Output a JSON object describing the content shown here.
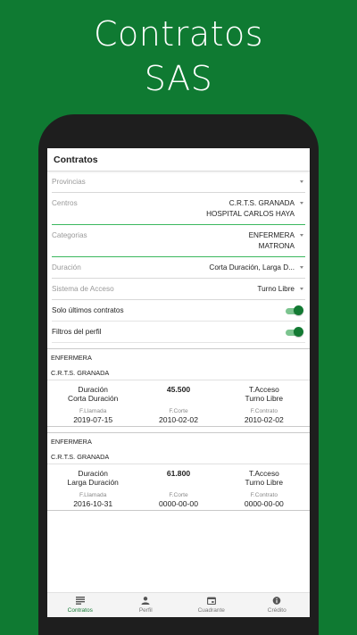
{
  "promo": {
    "line1": "Contratos",
    "line2": "SAS"
  },
  "appbar": {
    "title": "Contratos"
  },
  "filters": {
    "provincias": {
      "label": "Provincias",
      "value": ""
    },
    "centros": {
      "label": "Centros",
      "value_lines": [
        "C.R.T.S. GRANADA",
        "HOSPITAL CARLOS HAYA"
      ]
    },
    "categorias": {
      "label": "Categorias",
      "value_lines": [
        "ENFERMERA",
        "MATRONA"
      ]
    },
    "duracion": {
      "label": "Duración",
      "value": "Corta Duración, Larga D..."
    },
    "acceso": {
      "label": "Sistema de Acceso",
      "value": "Turno Libre"
    }
  },
  "toggles": {
    "ultimos": {
      "label": "Solo últimos contratos",
      "on": true
    },
    "perfil": {
      "label": "Filtros del perfil",
      "on": true
    }
  },
  "contracts": [
    {
      "categoria": "ENFERMERA",
      "centro": "C.R.T.S. GRANADA",
      "duracion_label": "Duración",
      "duracion": "Corta Duración",
      "puntos": "45.500",
      "acceso_label": "T.Acceso",
      "acceso": "Turno Libre",
      "f_llamada_label": "F.Llamada",
      "f_llamada": "2019-07-15",
      "f_corte_label": "F.Corte",
      "f_corte": "2010-02-02",
      "f_contrato_label": "F.Contrato",
      "f_contrato": "2010-02-02"
    },
    {
      "categoria": "ENFERMERA",
      "centro": "C.R.T.S. GRANADA",
      "duracion_label": "Duración",
      "duracion": "Larga Duración",
      "puntos": "61.800",
      "acceso_label": "T.Acceso",
      "acceso": "Turno Libre",
      "f_llamada_label": "F.Llamada",
      "f_llamada": "2016-10-31",
      "f_corte_label": "F.Corte",
      "f_corte": "0000-00-00",
      "f_contrato_label": "F.Contrato",
      "f_contrato": "0000-00-00"
    }
  ],
  "bottom_nav": [
    {
      "label": "Contratos",
      "icon": "list-icon",
      "active": true
    },
    {
      "label": "Perfil",
      "icon": "person-icon",
      "active": false
    },
    {
      "label": "Cuadrante",
      "icon": "calendar-icon",
      "active": false
    },
    {
      "label": "Crédito",
      "icon": "info-icon",
      "active": false
    }
  ],
  "colors": {
    "brand_green": "#0f7a32",
    "accent_green": "#3bb75e",
    "toggle_thumb": "#137a33"
  }
}
